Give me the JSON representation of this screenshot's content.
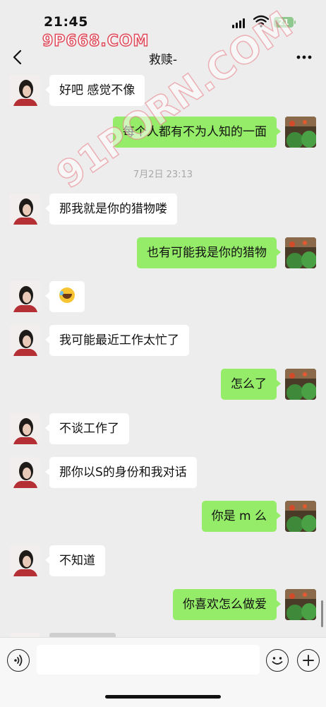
{
  "status": {
    "time": "21:45",
    "battery": "21"
  },
  "watermark": {
    "top": "9P668.COM",
    "mid": "91PORN.COM"
  },
  "nav": {
    "title": "救赎-"
  },
  "messages": [
    {
      "side": "in",
      "text": "好吧 感觉不像"
    },
    {
      "side": "out",
      "text": "每个人都有不为人知的一面"
    },
    {
      "timestamp": "7月2日 23:13"
    },
    {
      "side": "in",
      "text": "那我就是你的猎物喽"
    },
    {
      "side": "out",
      "text": "也有可能我是你的猎物"
    },
    {
      "side": "in",
      "emoji": "laughing-tears-icon"
    },
    {
      "side": "in",
      "text": "我可能最近工作太忙了"
    },
    {
      "side": "out",
      "text": "怎么了"
    },
    {
      "side": "in",
      "text": "不谈工作了"
    },
    {
      "side": "in",
      "text": "那你以S的身份和我对话"
    },
    {
      "side": "out",
      "text": "你是 m 么"
    },
    {
      "side": "in",
      "text": "不知道"
    },
    {
      "side": "out",
      "text": "你喜欢怎么做爱"
    }
  ],
  "input": {
    "placeholder": ""
  },
  "colors": {
    "out_bubble": "#95ec69",
    "in_bubble": "#ffffff",
    "background": "#ededed"
  }
}
